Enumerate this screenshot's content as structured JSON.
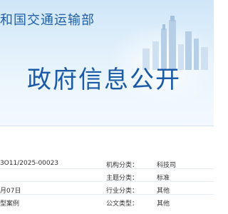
{
  "header": {
    "ministry_name": "和国交通运输部",
    "page_title": "政府信息公开"
  },
  "meta_rows": [
    {
      "left_text": "3O11/2025-00023",
      "label": "机构分类：",
      "value": "科技司"
    },
    {
      "left_text": "",
      "label": "主题分类：",
      "value": "标准"
    },
    {
      "left_text": "月07日",
      "label": "行业分类：",
      "value": "其他"
    },
    {
      "left_text": "型案例",
      "label": "公文类型：",
      "value": "其他"
    }
  ],
  "colors": {
    "title_blue": "#1a5aa8",
    "banner_light": "#e3f1fb"
  }
}
